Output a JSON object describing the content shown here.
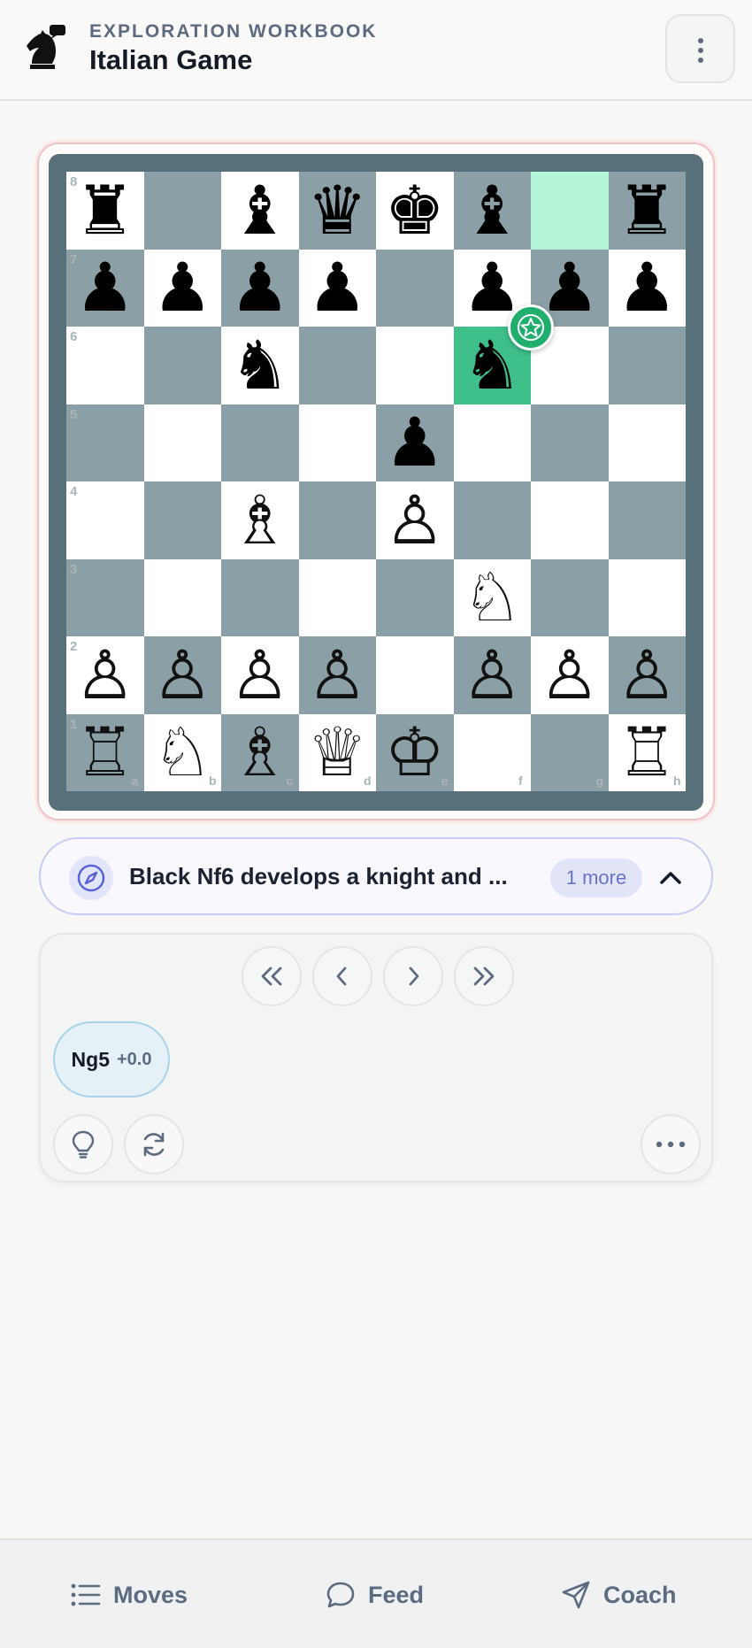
{
  "header": {
    "eyebrow": "EXPLORATION WORKBOOK",
    "title": "Italian Game"
  },
  "board": {
    "ranks": [
      "8",
      "7",
      "6",
      "5",
      "4",
      "3",
      "2",
      "1"
    ],
    "files": [
      "a",
      "b",
      "c",
      "d",
      "e",
      "f",
      "g",
      "h"
    ],
    "last_move_from": "g8",
    "last_move_to": "f6",
    "badge": "star",
    "pieces": [
      {
        "sq": "a8",
        "glyph": "♜",
        "color": "black"
      },
      {
        "sq": "c8",
        "glyph": "♝",
        "color": "black"
      },
      {
        "sq": "d8",
        "glyph": "♛",
        "color": "black"
      },
      {
        "sq": "e8",
        "glyph": "♚",
        "color": "black"
      },
      {
        "sq": "f8",
        "glyph": "♝",
        "color": "black"
      },
      {
        "sq": "h8",
        "glyph": "♜",
        "color": "black"
      },
      {
        "sq": "a7",
        "glyph": "♟",
        "color": "black"
      },
      {
        "sq": "b7",
        "glyph": "♟",
        "color": "black"
      },
      {
        "sq": "c7",
        "glyph": "♟",
        "color": "black"
      },
      {
        "sq": "d7",
        "glyph": "♟",
        "color": "black"
      },
      {
        "sq": "f7",
        "glyph": "♟",
        "color": "black"
      },
      {
        "sq": "g7",
        "glyph": "♟",
        "color": "black"
      },
      {
        "sq": "h7",
        "glyph": "♟",
        "color": "black"
      },
      {
        "sq": "c6",
        "glyph": "♞",
        "color": "black"
      },
      {
        "sq": "f6",
        "glyph": "♞",
        "color": "black"
      },
      {
        "sq": "e5",
        "glyph": "♟",
        "color": "black"
      },
      {
        "sq": "c4",
        "glyph": "♗",
        "color": "white"
      },
      {
        "sq": "e4",
        "glyph": "♙",
        "color": "white"
      },
      {
        "sq": "f3",
        "glyph": "♘",
        "color": "white"
      },
      {
        "sq": "a2",
        "glyph": "♙",
        "color": "white"
      },
      {
        "sq": "b2",
        "glyph": "♙",
        "color": "white"
      },
      {
        "sq": "c2",
        "glyph": "♙",
        "color": "white"
      },
      {
        "sq": "d2",
        "glyph": "♙",
        "color": "white"
      },
      {
        "sq": "f2",
        "glyph": "♙",
        "color": "white"
      },
      {
        "sq": "g2",
        "glyph": "♙",
        "color": "white"
      },
      {
        "sq": "h2",
        "glyph": "♙",
        "color": "white"
      },
      {
        "sq": "a1",
        "glyph": "♖",
        "color": "white"
      },
      {
        "sq": "b1",
        "glyph": "♘",
        "color": "white"
      },
      {
        "sq": "c1",
        "glyph": "♗",
        "color": "white"
      },
      {
        "sq": "d1",
        "glyph": "♕",
        "color": "white"
      },
      {
        "sq": "e1",
        "glyph": "♔",
        "color": "white"
      },
      {
        "sq": "h1",
        "glyph": "♖",
        "color": "white"
      }
    ]
  },
  "insight": {
    "text": "Black Nf6 develops a knight and ...",
    "more_label": "1 more"
  },
  "moves_panel": {
    "nav_icons": [
      "first-move-icon",
      "prev-move-icon",
      "next-move-icon",
      "last-move-icon"
    ],
    "candidate": {
      "san": "Ng5",
      "eval": "+0.0"
    }
  },
  "bottom_nav": {
    "moves": "Moves",
    "feed": "Feed",
    "coach": "Coach"
  },
  "colors": {
    "light_square": "#ffffff",
    "dark_square": "#8b9fa6",
    "highlight_to": "#3fbf8a",
    "highlight_from": "#b4f5d7",
    "accent": "#6a72c8"
  }
}
